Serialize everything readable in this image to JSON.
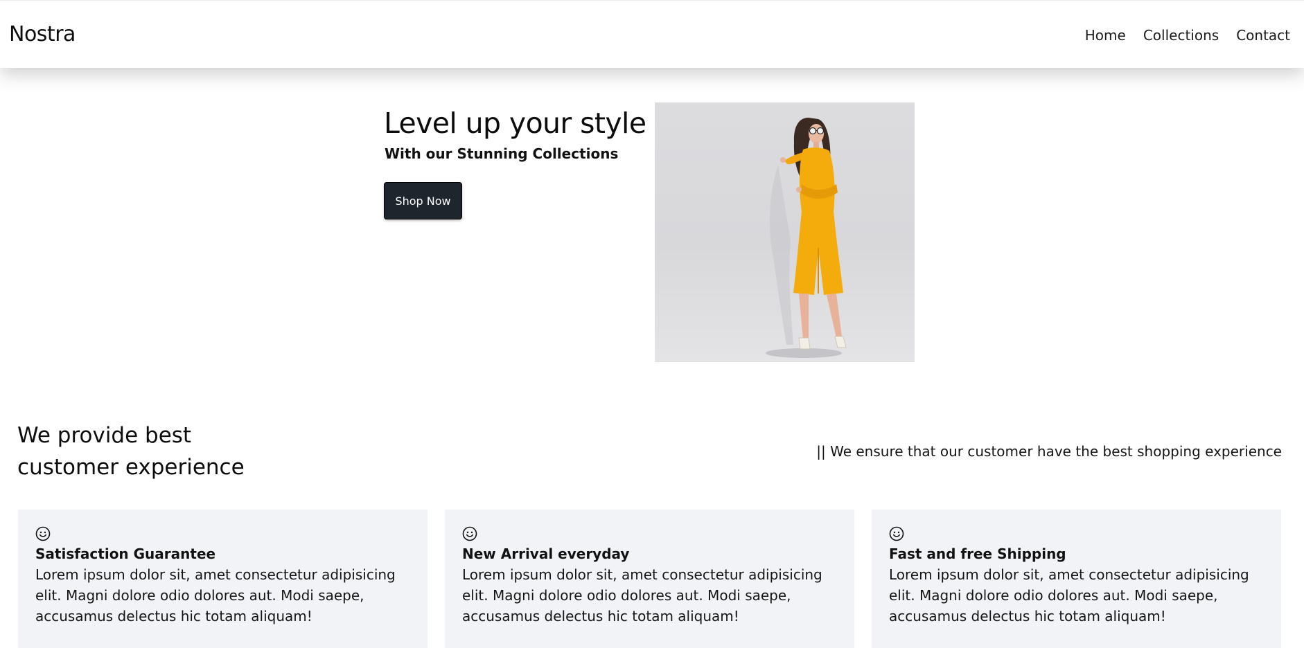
{
  "header": {
    "brand": "Nostra",
    "nav": [
      {
        "label": "Home"
      },
      {
        "label": "Collections"
      },
      {
        "label": "Contact"
      }
    ]
  },
  "hero": {
    "title": "Level up your style",
    "subtitle": "With our Stunning Collections",
    "cta_label": "Shop Now",
    "button_color": "#1f252d",
    "image_icon": "woman-in-yellow-outfit-photo"
  },
  "experience": {
    "heading": "We provide best customer experience",
    "tagline": "|| We ensure that our customer have the best shopping experience",
    "card_background": "#f2f3f6",
    "features": [
      {
        "icon": "smile-icon",
        "title": "Satisfaction Guarantee",
        "text": "Lorem ipsum dolor sit, amet consectetur adipisicing elit. Magni dolore odio dolores aut. Modi saepe, accusamus delectus hic totam aliquam!"
      },
      {
        "icon": "smile-icon",
        "title": "New Arrival everyday",
        "text": "Lorem ipsum dolor sit, amet consectetur adipisicing elit. Magni dolore odio dolores aut. Modi saepe, accusamus delectus hic totam aliquam!"
      },
      {
        "icon": "smile-icon",
        "title": "Fast and free Shipping",
        "text": "Lorem ipsum dolor sit, amet consectetur adipisicing elit. Magni dolore odio dolores aut. Modi saepe, accusamus delectus hic totam aliquam!"
      }
    ]
  }
}
